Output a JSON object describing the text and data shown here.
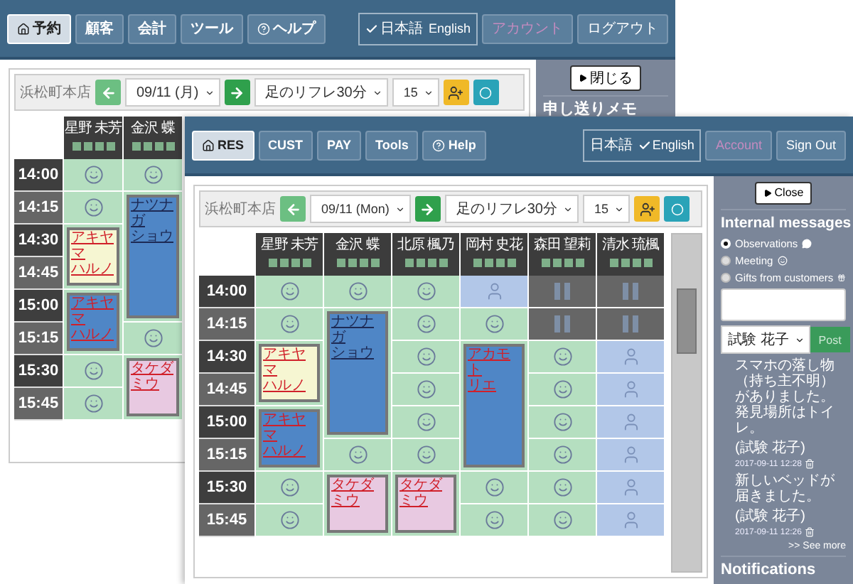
{
  "windows": [
    {
      "nav": [
        {
          "label": "予約",
          "selected": true
        },
        {
          "label": "顧客",
          "selected": false
        },
        {
          "label": "会計",
          "selected": false
        },
        {
          "label": "ツール",
          "selected": false
        },
        {
          "label": "ヘルプ",
          "selected": false
        }
      ],
      "languages": [
        {
          "label": "日本語",
          "selected": true
        },
        {
          "label": "English",
          "selected": false
        }
      ],
      "account": {
        "label": "アカウント",
        "disabled": true
      },
      "logout": "ログアウト",
      "toolbar": {
        "store": "浜松町本店",
        "date": "09/11 (月)",
        "menu": "足のリフレ30分",
        "interval": "15"
      },
      "times": [
        "14:00",
        "14:15",
        "14:30",
        "14:45",
        "15:00",
        "15:15",
        "15:30",
        "15:45"
      ],
      "staff": [
        {
          "name": "星野 未芳",
          "cells": [
            {
              "kind": "free"
            },
            {
              "kind": "free"
            },
            {
              "kind": "booking",
              "family": "アキヤマ",
              "given": "ハルノ",
              "color": "#f6f6d2"
            },
            {
              "kind": "covered"
            },
            {
              "kind": "booking",
              "family": "アキヤマ",
              "given": "ハルノ",
              "color": "#4f86c6"
            },
            {
              "kind": "covered"
            },
            {
              "kind": "free"
            },
            {
              "kind": "free"
            }
          ]
        },
        {
          "name": "金沢 蝶",
          "cells": [
            {
              "kind": "free"
            },
            {
              "kind": "booking",
              "family": "ナツナガ",
              "given": "ショウ",
              "color": "#4f86c6"
            },
            {
              "kind": "covered"
            },
            {
              "kind": "covered"
            },
            {
              "kind": "covered"
            },
            {
              "kind": "free"
            },
            {
              "kind": "booking",
              "family": "タケダ",
              "given": "ミウ",
              "color": "#e8c9e1"
            },
            {
              "kind": "covered"
            }
          ]
        }
      ],
      "sidebar": {
        "close": "閉じる",
        "heading": "申し送りメモ"
      }
    },
    {
      "nav": [
        {
          "label": "RES",
          "selected": true
        },
        {
          "label": "CUST",
          "selected": false
        },
        {
          "label": "PAY",
          "selected": false
        },
        {
          "label": "Tools",
          "selected": false
        },
        {
          "label": "Help",
          "selected": false
        }
      ],
      "languages": [
        {
          "label": "日本語",
          "selected": false
        },
        {
          "label": "English",
          "selected": true
        }
      ],
      "account": {
        "label": "Account",
        "disabled": true
      },
      "logout": "Sign Out",
      "toolbar": {
        "store": "浜松町本店",
        "date": "09/11 (Mon)",
        "menu": "足のリフレ30分",
        "interval": "15"
      },
      "times": [
        "14:00",
        "14:15",
        "14:30",
        "14:45",
        "15:00",
        "15:15",
        "15:30",
        "15:45"
      ],
      "staff": [
        {
          "name": "星野 未芳",
          "cells": [
            {
              "kind": "free"
            },
            {
              "kind": "free"
            },
            {
              "kind": "booking",
              "family": "アキヤマ",
              "given": "ハルノ",
              "color": "#f6f6d2"
            },
            {
              "kind": "covered"
            },
            {
              "kind": "booking",
              "family": "アキヤマ",
              "given": "ハルノ",
              "color": "#4f86c6"
            },
            {
              "kind": "covered"
            },
            {
              "kind": "free"
            },
            {
              "kind": "free"
            }
          ]
        },
        {
          "name": "金沢 蝶",
          "cells": [
            {
              "kind": "free"
            },
            {
              "kind": "booking",
              "family": "ナツナガ",
              "given": "ショウ",
              "color": "#4f86c6"
            },
            {
              "kind": "covered"
            },
            {
              "kind": "covered"
            },
            {
              "kind": "covered"
            },
            {
              "kind": "free"
            },
            {
              "kind": "booking",
              "family": "タケダ",
              "given": "ミウ",
              "color": "#e8c9e1"
            },
            {
              "kind": "covered"
            }
          ]
        },
        {
          "name": "北原 楓乃",
          "cells": [
            {
              "kind": "free"
            },
            {
              "kind": "free"
            },
            {
              "kind": "free"
            },
            {
              "kind": "free"
            },
            {
              "kind": "free"
            },
            {
              "kind": "free"
            },
            {
              "kind": "booking",
              "family": "タケダ",
              "given": "ミウ",
              "color": "#e8c9e1"
            },
            {
              "kind": "covered"
            }
          ]
        },
        {
          "name": "岡村 史花",
          "cells": [
            {
              "kind": "shift"
            },
            {
              "kind": "free"
            },
            {
              "kind": "booking",
              "family": "アカモト",
              "given": "リエ",
              "color": "#4f86c6"
            },
            {
              "kind": "covered"
            },
            {
              "kind": "covered"
            },
            {
              "kind": "covered"
            },
            {
              "kind": "free"
            },
            {
              "kind": "free"
            }
          ]
        },
        {
          "name": "森田 望莉",
          "cells": [
            {
              "kind": "off"
            },
            {
              "kind": "off"
            },
            {
              "kind": "free"
            },
            {
              "kind": "free"
            },
            {
              "kind": "free"
            },
            {
              "kind": "free"
            },
            {
              "kind": "free"
            },
            {
              "kind": "free"
            }
          ]
        },
        {
          "name": "清水 琉楓",
          "cells": [
            {
              "kind": "off"
            },
            {
              "kind": "off"
            },
            {
              "kind": "shift"
            },
            {
              "kind": "shift"
            },
            {
              "kind": "shift"
            },
            {
              "kind": "shift"
            },
            {
              "kind": "shift"
            },
            {
              "kind": "shift"
            }
          ]
        }
      ],
      "sidebar": {
        "close": "Close",
        "heading": "Internal messages",
        "options": [
          {
            "label": "Observations",
            "selected": true
          },
          {
            "label": "Meeting",
            "selected": false
          },
          {
            "label": "Gifts from customers",
            "selected": false
          }
        ],
        "author_select": "試験 花子",
        "post": "Post",
        "messages": [
          {
            "text": "スマホの落し物（持ち主不明）がありました。発見場所はトイレ。",
            "author": "(試験 花子)",
            "time": "2017-09-11 12:28"
          },
          {
            "text": "新しいベッドが届きました。",
            "author": "(試験 花子)",
            "time": "2017-09-11 12:26"
          }
        ],
        "see_more": ">> See more",
        "notifications": "Notifications"
      }
    }
  ]
}
